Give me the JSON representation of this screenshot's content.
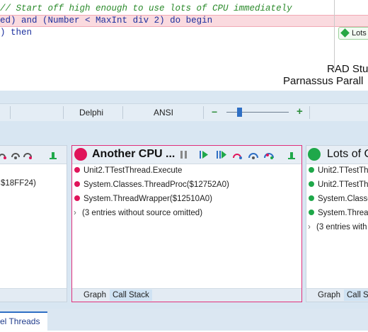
{
  "editor": {
    "line1": "// Start off high enough to use lots of CPU immediately",
    "line2_a": "ed) ",
    "line2_b": "and",
    "line2_c": " (Number < MaxInt ",
    "line2_d": "div",
    "line2_e": " 2) ",
    "line2_f": "do begin",
    "line3_a": ") ",
    "line3_b": "then",
    "marker_label": "Lots"
  },
  "ide": {
    "title": "RAD Stu",
    "subtitle": "Parnassus Parall"
  },
  "statusbar": {
    "language": "Delphi",
    "encoding": "ANSI",
    "zoom_minus": "−",
    "zoom_plus": "+",
    "zoom_level": 0.2
  },
  "threads": {
    "left": {
      "entries": [
        "$18FF24)"
      ]
    },
    "middle": {
      "title": "Another CPU ...",
      "entries": [
        "Unit2.TTestThread.Execute",
        "System.Classes.ThreadProc($12752A0)",
        "System.ThreadWrapper($12510A0)"
      ],
      "omitted": "(3 entries without source omitted)",
      "tabs": [
        "Graph",
        "Call Stack"
      ]
    },
    "right": {
      "title": "Lots of C",
      "entries": [
        "Unit2.TTestTh",
        "Unit2.TTestTh",
        "System.Classe",
        "System.Threa"
      ],
      "omitted": "(3 entries with",
      "tabs": [
        "Graph",
        "Call S"
      ]
    }
  },
  "bottom_tab": "el Threads",
  "colors": {
    "stopped_thread": "#e0145a",
    "running_thread": "#1fa84a",
    "accent": "#2f6fc4"
  }
}
